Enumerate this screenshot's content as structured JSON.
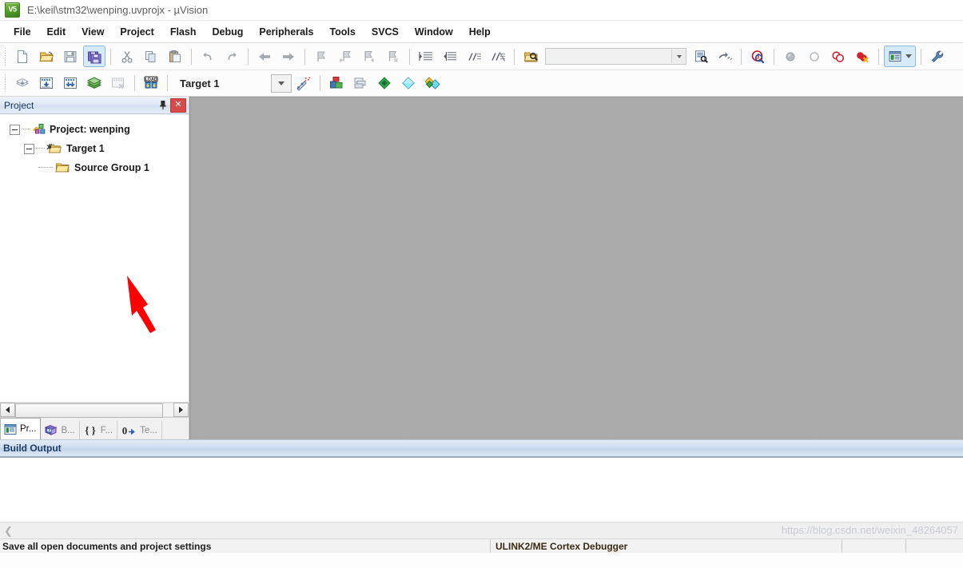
{
  "window": {
    "icon": "uvision-logo-icon",
    "icon_text": "V5",
    "title": "E:\\keil\\stm32\\wenping.uvprojx - µVision"
  },
  "menubar": {
    "items": [
      {
        "label": "File"
      },
      {
        "label": "Edit"
      },
      {
        "label": "View"
      },
      {
        "label": "Project"
      },
      {
        "label": "Flash"
      },
      {
        "label": "Debug"
      },
      {
        "label": "Peripherals"
      },
      {
        "label": "Tools"
      },
      {
        "label": "SVCS"
      },
      {
        "label": "Window"
      },
      {
        "label": "Help"
      }
    ]
  },
  "file_toolbar": {
    "buttons": [
      {
        "name": "new-file-button",
        "icon": "new-document-icon",
        "tooltip": "New"
      },
      {
        "name": "open-file-button",
        "icon": "open-folder-icon",
        "tooltip": "Open"
      },
      {
        "name": "save-button",
        "icon": "floppy-disk-icon",
        "tooltip": "Save"
      },
      {
        "name": "save-all-button",
        "icon": "save-all-icon",
        "tooltip": "Save All",
        "active": true
      },
      {
        "name": "cut-button",
        "icon": "scissors-icon",
        "tooltip": "Cut"
      },
      {
        "name": "copy-button",
        "icon": "copy-icon",
        "tooltip": "Copy"
      },
      {
        "name": "paste-button",
        "icon": "clipboard-paste-icon",
        "tooltip": "Paste"
      },
      {
        "name": "undo-button",
        "icon": "undo-arrow-icon",
        "tooltip": "Undo"
      },
      {
        "name": "redo-button",
        "icon": "redo-arrow-icon",
        "tooltip": "Redo"
      },
      {
        "name": "navigate-back-button",
        "icon": "arrow-left-icon",
        "tooltip": "Back"
      },
      {
        "name": "navigate-forward-button",
        "icon": "arrow-right-icon",
        "tooltip": "Forward"
      },
      {
        "name": "toggle-bookmark-button",
        "icon": "bookmark-icon",
        "tooltip": "Insert/Remove Bookmark"
      },
      {
        "name": "previous-bookmark-button",
        "icon": "bookmark-prev-icon",
        "tooltip": "Previous Bookmark"
      },
      {
        "name": "next-bookmark-button",
        "icon": "bookmark-next-icon",
        "tooltip": "Next Bookmark"
      },
      {
        "name": "clear-bookmarks-button",
        "icon": "bookmark-clear-icon",
        "tooltip": "Clear All Bookmarks"
      },
      {
        "name": "indent-button",
        "icon": "indent-right-icon",
        "tooltip": "Indent Selected Text"
      },
      {
        "name": "outdent-button",
        "icon": "indent-left-icon",
        "tooltip": "Unindent Selected Text"
      },
      {
        "name": "comment-button",
        "icon": "comment-lines-icon",
        "tooltip": "Comment Selection"
      },
      {
        "name": "uncomment-button",
        "icon": "uncomment-lines-icon",
        "tooltip": "Uncomment Selection"
      },
      {
        "name": "find-in-files-button",
        "icon": "find-in-files-icon",
        "tooltip": "Find in Files"
      }
    ],
    "search_combo": {
      "name": "search-combo",
      "value": "",
      "placeholder": ""
    },
    "right_buttons": [
      {
        "name": "browse-symbols-button",
        "icon": "document-search-icon",
        "tooltip": "Browse Symbols"
      },
      {
        "name": "goto-definition-button",
        "icon": "jump-definition-icon",
        "tooltip": "Go To Definition"
      },
      {
        "name": "find-button",
        "icon": "magnifier-red-icon",
        "tooltip": "Find"
      },
      {
        "name": "insert-breakpoint-button",
        "icon": "breakpoint-gray-icon",
        "tooltip": "Insert/Remove Breakpoint"
      },
      {
        "name": "disable-breakpoint-button",
        "icon": "breakpoint-hollow-icon",
        "tooltip": "Enable/Disable Breakpoint"
      },
      {
        "name": "disable-all-breakpoints-button",
        "icon": "breakpoints-disable-all-icon",
        "tooltip": "Disable All Breakpoints"
      },
      {
        "name": "kill-all-breakpoints-button",
        "icon": "breakpoints-kill-all-icon",
        "tooltip": "Kill All Breakpoints"
      },
      {
        "name": "manage-windows-button",
        "icon": "window-layout-icon",
        "tooltip": "Manage Windows",
        "active": true
      },
      {
        "name": "configuration-button",
        "icon": "wrench-icon",
        "tooltip": "Configuration"
      }
    ]
  },
  "build_toolbar": {
    "buttons": [
      {
        "name": "translate-file-button",
        "icon": "translate-icon",
        "tooltip": "Translate Current File"
      },
      {
        "name": "build-target-button",
        "icon": "build-icon",
        "tooltip": "Build"
      },
      {
        "name": "rebuild-all-button",
        "icon": "rebuild-icon",
        "tooltip": "Rebuild all target files"
      },
      {
        "name": "batch-build-button",
        "icon": "batch-build-icon",
        "tooltip": "Batch Build"
      },
      {
        "name": "stop-build-button",
        "icon": "stop-build-icon",
        "tooltip": "Stop Build"
      },
      {
        "name": "download-button",
        "icon": "load-download-icon",
        "tooltip": "Download",
        "badge": "LOAD"
      }
    ],
    "target_label": "Target 1",
    "target_dropdown": {
      "name": "target-select",
      "value": "Target 1"
    },
    "right_buttons": [
      {
        "name": "options-wizard-button",
        "icon": "config-wizard-icon",
        "tooltip": "Configuration Wizard"
      },
      {
        "name": "target-options-button",
        "icon": "target-options-icon",
        "tooltip": "Options for Target"
      },
      {
        "name": "manage-project-items-button",
        "icon": "manage-components-icon",
        "tooltip": "Manage Project Items"
      },
      {
        "name": "pack-installer-button",
        "icon": "green-diamond-icon",
        "tooltip": "Pack Installer"
      },
      {
        "name": "manage-run-time-button",
        "icon": "cyan-diamond-icon",
        "tooltip": "Manage Run-Time Environment"
      },
      {
        "name": "select-software-packs-button",
        "icon": "multi-diamond-icon",
        "tooltip": "Select Software Packs"
      }
    ]
  },
  "project_pane": {
    "title": "Project",
    "pin_icon": "pin-icon",
    "close_icon": "close-icon",
    "tree": [
      {
        "label": "Project: wenping",
        "icon": "project-icon",
        "level": 0,
        "expanded": true
      },
      {
        "label": "Target 1",
        "icon": "target-folder-icon",
        "level": 1,
        "expanded": true
      },
      {
        "label": "Source Group 1",
        "icon": "folder-icon",
        "level": 2,
        "expanded": false
      }
    ],
    "tabs": [
      {
        "label": "Pr...",
        "icon": "project-tab-icon",
        "active": true
      },
      {
        "label": "B...",
        "icon": "books-tab-icon",
        "active": false
      },
      {
        "label": "F...",
        "icon": "functions-tab-icon",
        "active": false
      },
      {
        "label": "Te...",
        "icon": "templates-tab-icon",
        "active": false
      }
    ],
    "scrollbar": {
      "left_arrow": "arrow-left-icon",
      "right_arrow": "arrow-right-icon"
    }
  },
  "build_output": {
    "title": "Build Output",
    "content": "",
    "watermark": "https://blog.csdn.net/weixin_48264057"
  },
  "statusbar": {
    "message": "Save all open documents and project settings",
    "debugger": "ULINK2/ME Cortex Debugger"
  },
  "annotation": {
    "arrow_color": "#fe0000",
    "points_at": "Source Group 1"
  },
  "colors": {
    "mdi_background": "#aaaaaa",
    "accent": "#d6eaf9",
    "pane_header": "#dde7f3",
    "close_red": "#d64a4a"
  }
}
